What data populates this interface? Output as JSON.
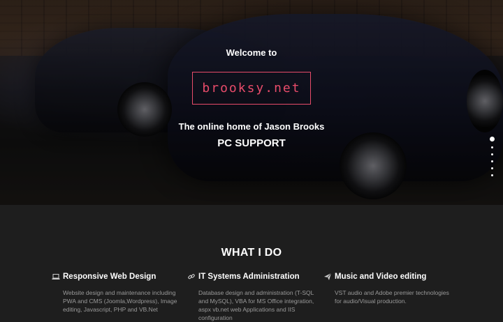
{
  "hero": {
    "welcome": "Welcome to",
    "logo": "brooksy.net",
    "tagline": "The online home of Jason Brooks",
    "subtitle": "PC SUPPORT",
    "slide_indicator": {
      "active": 1,
      "total": 6
    }
  },
  "colors": {
    "accent": "#e84c6a",
    "section_bg": "#1e1e1e",
    "muted_text": "#9a9a9a"
  },
  "what_i_do": {
    "title": "WHAT I DO",
    "services": [
      {
        "icon": "laptop-icon",
        "title": "Responsive Web Design",
        "text": "Website design and maintenance including PWA and CMS (Joomla,Wordpress), Image editing, Javascript, PHP and VB.Net"
      },
      {
        "icon": "link-icon",
        "title": "IT Systems Administration",
        "text": "Database design and administration (T-SQL and MySQL), VBA for MS Office integration, aspx vb.net web Applications and IIS configuration"
      },
      {
        "icon": "paper-plane-icon",
        "title": "Music and Video editing",
        "text": "VST audio and Adobe premier technologies for audio/Visual production."
      }
    ]
  }
}
